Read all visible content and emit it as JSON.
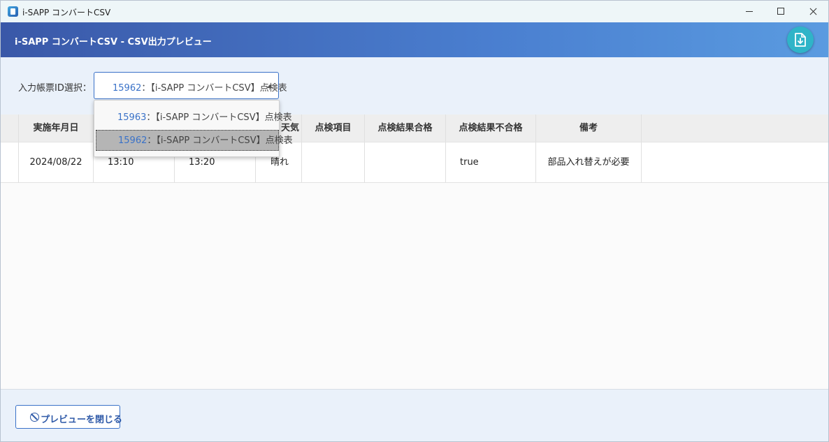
{
  "app": {
    "window_title": "i-SAPP  コンバートCSV",
    "header_title": "i-SAPP  コンバートCSV - CSV出力プレビュー"
  },
  "filter": {
    "label": "入力帳票ID選択：",
    "selected": {
      "id": "15962",
      "name": "：【i-SAPP コンバートCSV】点検表"
    },
    "options": [
      {
        "id": "15963",
        "name": "：【i-SAPP コンバートCSV】点検表"
      },
      {
        "id": "15962",
        "name": "：【i-SAPP コンバートCSV】点検表"
      }
    ]
  },
  "table": {
    "headers": {
      "date": "実施年月日",
      "weather": "天気",
      "item": "点検項目",
      "pass": "点検結果合格",
      "fail": "点検結果不合格",
      "notes": "備考"
    },
    "rows": [
      {
        "date": "2024/08/22",
        "start": "13:10",
        "end": "13:20",
        "weather": "晴れ",
        "item": "",
        "pass": "",
        "fail": "true",
        "notes": "部品入れ替えが必要"
      }
    ]
  },
  "footer": {
    "close_label": "プレビューを閉じる"
  },
  "colors": {
    "accent": "#3a72c8",
    "header_start": "#3a58a8",
    "header_end": "#5a9be0",
    "export_button": "#2fb4c8"
  },
  "icons": {
    "app": "app-icon",
    "export": "file-download-icon",
    "close": "ban-icon",
    "dropdown": "caret-up-icon"
  }
}
